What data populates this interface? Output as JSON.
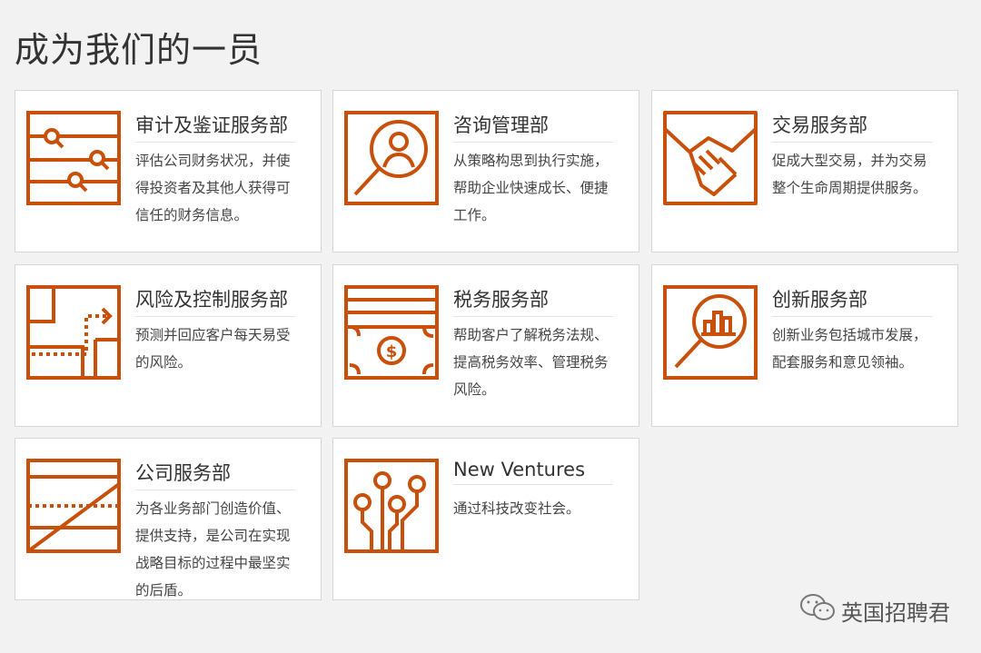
{
  "page": {
    "title": "成为我们的一员"
  },
  "accent_color": "#c8500a",
  "cards": [
    {
      "icon": "audit-search-icon",
      "title": "审计及鉴证服务部",
      "desc": "评估公司财务状况，并使得投资者及其他人获得可信任的财务信息。"
    },
    {
      "icon": "consulting-magnifier-person-icon",
      "title": "咨询管理部",
      "desc": "从策略构思到执行实施，帮助企业快速成长、便捷工作。"
    },
    {
      "icon": "handshake-icon",
      "title": "交易服务部",
      "desc": "促成大型交易，并为交易整个生命周期提供服务。"
    },
    {
      "icon": "risk-path-icon",
      "title": "风险及控制服务部",
      "desc": "预测并回应客户每天易受的风险。"
    },
    {
      "icon": "tax-money-icon",
      "title": "税务服务部",
      "desc": "帮助客户了解税务法规、提高税务效率、管理税务风险。"
    },
    {
      "icon": "innovation-chart-magnifier-icon",
      "title": "创新服务部",
      "desc": "创新业务包括城市发展，配套服务和意见领袖。"
    },
    {
      "icon": "corporate-lines-icon",
      "title": "公司服务部",
      "desc": "为各业务部门创造价值、提供支持，是公司在实现战略目标的过程中最坚实的后盾。"
    },
    {
      "icon": "circuit-icon",
      "title": "New Ventures",
      "desc": "通过科技改变社会。"
    }
  ],
  "watermark": {
    "icon": "wechat-icon",
    "text": "英国招聘君"
  }
}
